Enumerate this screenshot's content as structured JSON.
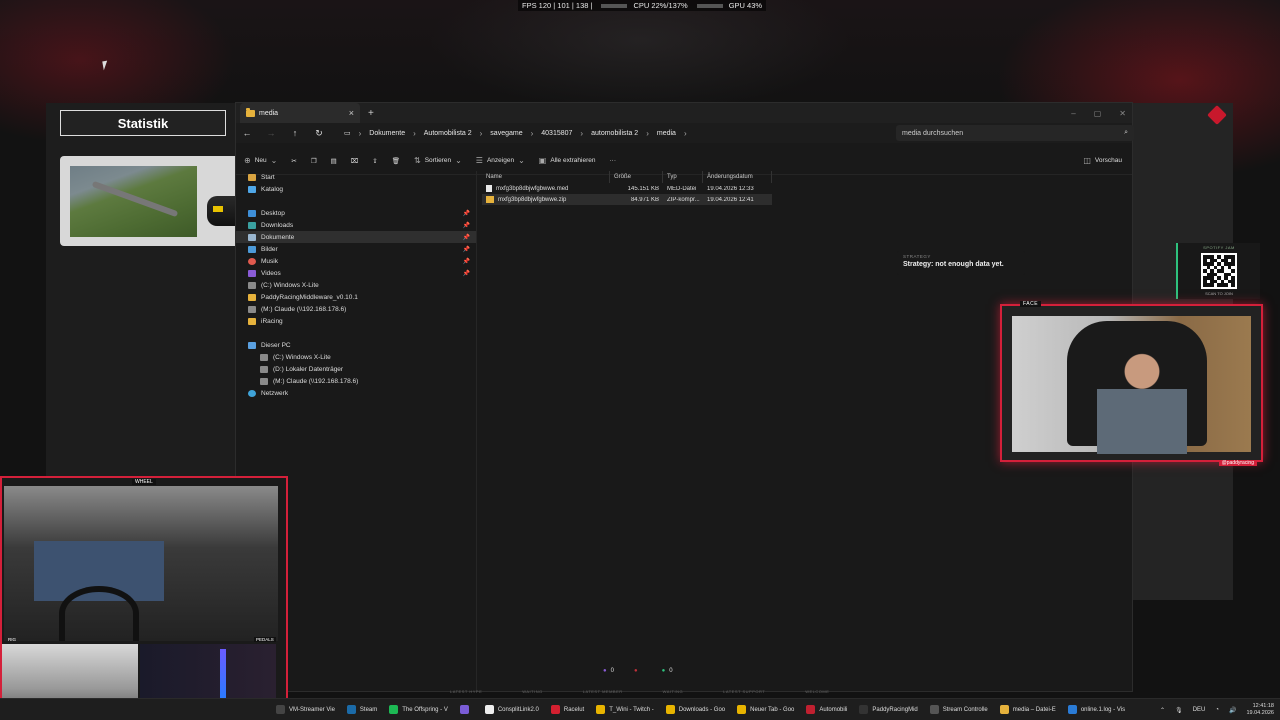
{
  "top_stats": {
    "fps": "FPS 120 | 101 | 138 |",
    "cpu": "CPU 22%/137%",
    "gpu": "GPU 43%"
  },
  "game": {
    "stat_title": "Statistik"
  },
  "explorer": {
    "tab_title": "media",
    "tab_close": "×",
    "new_tab": "+",
    "window_controls": [
      "–",
      "▢",
      "✕"
    ],
    "breadcrumb": [
      "Dokumente",
      "Automobilista 2",
      "savegame",
      "40315807",
      "automobilista 2",
      "media"
    ],
    "search_placeholder": "media durchsuchen",
    "commands": {
      "new": "Neu",
      "sort": "Sortieren",
      "view": "Anzeigen",
      "extract": "Alle extrahieren",
      "more": "···",
      "preview": "Vorschau"
    },
    "nav": {
      "start": "Start",
      "katalog": "Katalog",
      "desktop": "Desktop",
      "downloads": "Downloads",
      "dokumente": "Dokumente",
      "bilder": "Bilder",
      "musik": "Musik",
      "videos": "Videos",
      "c_drive": "(C:) Windows X-Lite",
      "paddy": "PaddyRacingMiddleware_v0.10.1",
      "m_claude": "(M:) Claude (\\\\192.168.178.6)",
      "iracing": "iRacing",
      "dieser_pc": "Dieser PC",
      "pc_c": "(C:) Windows X-Lite",
      "pc_d": "(D:) Lokaler Datenträger",
      "pc_m": "(M:) Claude (\\\\192.168.178.6)",
      "netzwerk": "Netzwerk"
    },
    "columns": {
      "name": "Name",
      "size": "Größe",
      "type": "Typ",
      "date": "Änderungsdatum"
    },
    "files": [
      {
        "name": "mxfg3bp8dbjwfgbwwe.med",
        "size": "145.151 KB",
        "type": "MED-Datei",
        "date": "19.04.2026 12:33"
      },
      {
        "name": "mxfg3bp8dbjwfgbwwe.zip",
        "size": "84.971 KB",
        "type": "ZIP-kompr...",
        "date": "19.04.2026 12:41"
      }
    ]
  },
  "strategy": {
    "label": "STRATEGY",
    "text": "Strategy: not enough data yet."
  },
  "qr": {
    "label": "SPOTIFY JAM",
    "scan": "SCAN TO JOIN"
  },
  "cams": {
    "face": "FACE",
    "face_tag": "@paddyracing",
    "wheel": "WHEEL",
    "rig": "RIG",
    "pedals": "PEDALS"
  },
  "status": {
    "a": "0",
    "b": "",
    "c": "0"
  },
  "overlay_strip": [
    "LATEST HYPE",
    "WAITING",
    "LATEST MEMBER",
    "WAITING",
    "LATEST SUPPORT",
    "WELCOME"
  ],
  "taskbar": {
    "items": [
      {
        "label": "VM-Streamer Vie",
        "color": "#444"
      },
      {
        "label": "Steam",
        "color": "#1b6ba8"
      },
      {
        "label": "The Offspring - V",
        "color": "#1db954"
      },
      {
        "label": "",
        "color": "#7a5cd6"
      },
      {
        "label": "ConsplitLink2.0",
        "color": "#eee"
      },
      {
        "label": "Racelut",
        "color": "#d42030"
      },
      {
        "label": "T_Wini - Twitch -",
        "color": "#e8b400"
      },
      {
        "label": "Downloads - Goo",
        "color": "#e8b400"
      },
      {
        "label": "Neuer Tab - Goo",
        "color": "#e8b400"
      },
      {
        "label": "Automobili",
        "color": "#c02030"
      },
      {
        "label": "PaddyRacingMid",
        "color": "#333"
      },
      {
        "label": "Stream Controlle",
        "color": "#555"
      },
      {
        "label": "media – Datei-E",
        "color": "#e6b23c"
      },
      {
        "label": "online.1.log - Vis",
        "color": "#2a7bd6"
      }
    ],
    "lang": "DEU",
    "time": "12:41:18",
    "date": "19.04.2026"
  }
}
